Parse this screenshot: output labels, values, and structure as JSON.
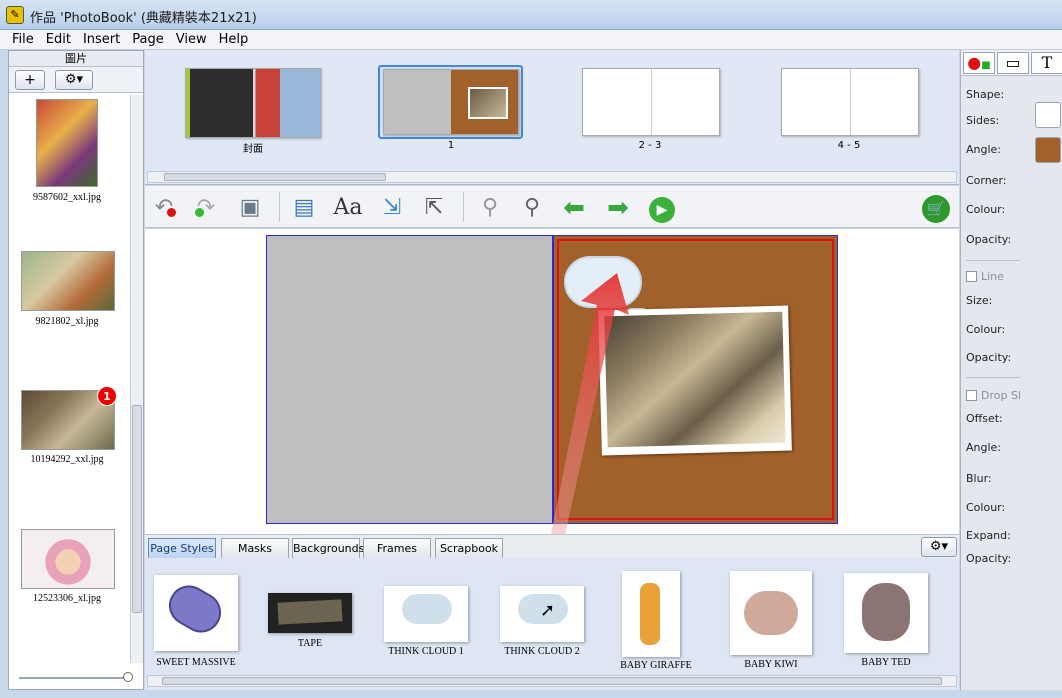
{
  "window": {
    "title": "作品 'PhotoBook' (典藏精裝本21x21)"
  },
  "menu": [
    "File",
    "Edit",
    "Insert",
    "Page",
    "View",
    "Help"
  ],
  "photos_panel": {
    "header": "圖片",
    "add_label": "+",
    "badge_count": "1",
    "items": [
      {
        "filename": "9587602_xxl.jpg"
      },
      {
        "filename": "9821802_xl.jpg"
      },
      {
        "filename": "10194292_xxl.jpg"
      },
      {
        "filename": "12523306_xl.jpg"
      }
    ]
  },
  "pages": [
    {
      "label": "封面"
    },
    {
      "label": "1"
    },
    {
      "label": "2 - 3"
    },
    {
      "label": "4 - 5"
    }
  ],
  "toolbar": {
    "icons": [
      "undo-icon",
      "redo-icon",
      "save-icon",
      "add-photo-icon",
      "add-text-icon",
      "import-icon",
      "export-icon",
      "zoom-out-icon",
      "zoom-in-icon",
      "prev-page-icon",
      "next-page-icon",
      "play-icon",
      "cart-icon"
    ]
  },
  "tabs": [
    {
      "label": "Page Styles",
      "active": true
    },
    {
      "label": "Masks",
      "active": false
    },
    {
      "label": "Backgrounds",
      "active": false
    },
    {
      "label": "Frames",
      "active": false
    },
    {
      "label": "Scrapbook",
      "active": false
    }
  ],
  "styles": [
    {
      "label": "SWEET MASSIVE"
    },
    {
      "label": "TAPE"
    },
    {
      "label": "THINK CLOUD 1"
    },
    {
      "label": "THINK CLOUD 2"
    },
    {
      "label": "BABY GIRAFFE"
    },
    {
      "label": "BABY KIWI"
    },
    {
      "label": "BABY TED"
    }
  ],
  "properties": {
    "shape": "Shape:",
    "sides": "Sides:",
    "angle": "Angle:",
    "corner": "Corner:",
    "colour": "Colour:",
    "opacity": "Opacity:",
    "line": "Line",
    "size": "Size:",
    "line_colour": "Colour:",
    "line_opacity": "Opacity:",
    "drop_shadow": "Drop Sl",
    "offset": "Offset:",
    "shadow_angle": "Angle:",
    "blur": "Blur:",
    "shadow_colour": "Colour:",
    "expand": "Expand:",
    "shadow_opacity": "Opacity:",
    "fill_color": "#a2612a",
    "line_color": "#ffffff"
  }
}
